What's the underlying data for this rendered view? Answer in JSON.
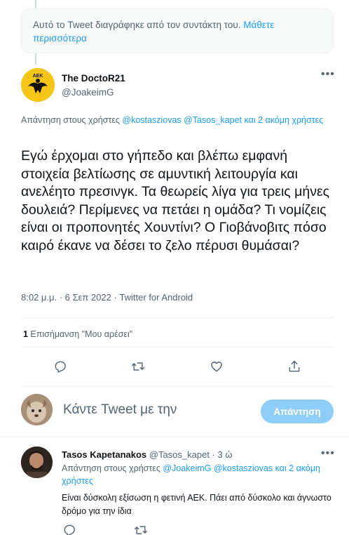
{
  "deleted_notice": {
    "text": "Αυτό το Tweet διαγράφηκε από τον συντάκτη του. ",
    "link": "Μάθετε περισσότερα"
  },
  "main_tweet": {
    "author_name": "The DoctoR21",
    "author_handle": "@JoakeimG",
    "avatar_text": "ΑΕΚ",
    "replying_prefix": "Απάντηση στους χρήστες ",
    "mention_1": "@kostasziovas",
    "mention_2": "@Tasos_kapet",
    "mention_more": " και 2 ακόμη χρήστες",
    "text": "Εγώ έρχομαι στο γήπεδο και βλέπω εμφανή στοιχεία βελτίωσης σε αμυντική λειτουργία και ανελέητο πρεσινγκ. Τα θεωρείς λίγα για τρεις μήνες δουλειά? Περίμενες να πετάει η ομάδα? Τι νομίζεις είναι οι προπονητές Χουντίνι? Ο Γιοβάνοβιτς πόσο καιρό έκανε να δέσει το ζελο πέρυσι θυμάσαι?",
    "timestamp": "8:02 μ.μ. · 6 Σεπ 2022 · Twitter for Android",
    "likes_count": "1",
    "likes_label": " Επισήμανση \"Μου αρέσει\""
  },
  "compose": {
    "placeholder": "Κάντε Tweet με την",
    "reply_button": "Απάντηση"
  },
  "reply_tweet": {
    "author_name": "Tasos Kapetanakos",
    "author_handle": " @Tasos_kapet · 3 ώ",
    "replying_prefix": "Απάντηση στους χρήστες ",
    "mention_1": "@JoakeimG",
    "mention_2": "@kostasziovas",
    "mention_more": " και 2 ακόμη χρήστες",
    "text": "Είναι δύσκολη εξίσωση η φετινή ΑΕΚ. Πάει από δύσκολο και άγνωστο δρόμο για την ίδια"
  },
  "more_icon_text": "•••",
  "colors": {
    "accent": "#1d9bf0",
    "reply_button_disabled": "#8ecdf8",
    "secondary_text": "#536471",
    "primary_text": "#0f1419",
    "aek_yellow": "#f5c518"
  }
}
